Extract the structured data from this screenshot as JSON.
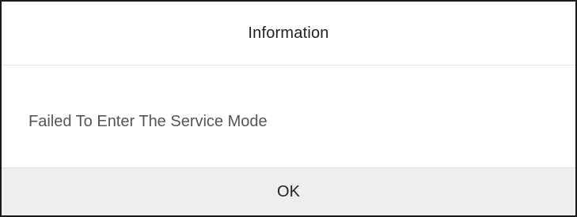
{
  "dialog": {
    "title": "Information",
    "message": "Failed To Enter The Service Mode",
    "ok_label": "OK"
  },
  "colors": {
    "border": "#1a1a1a",
    "title_text": "#222222",
    "message_text": "#555555",
    "footer_background": "#eeeeee",
    "background": "#ffffff"
  }
}
